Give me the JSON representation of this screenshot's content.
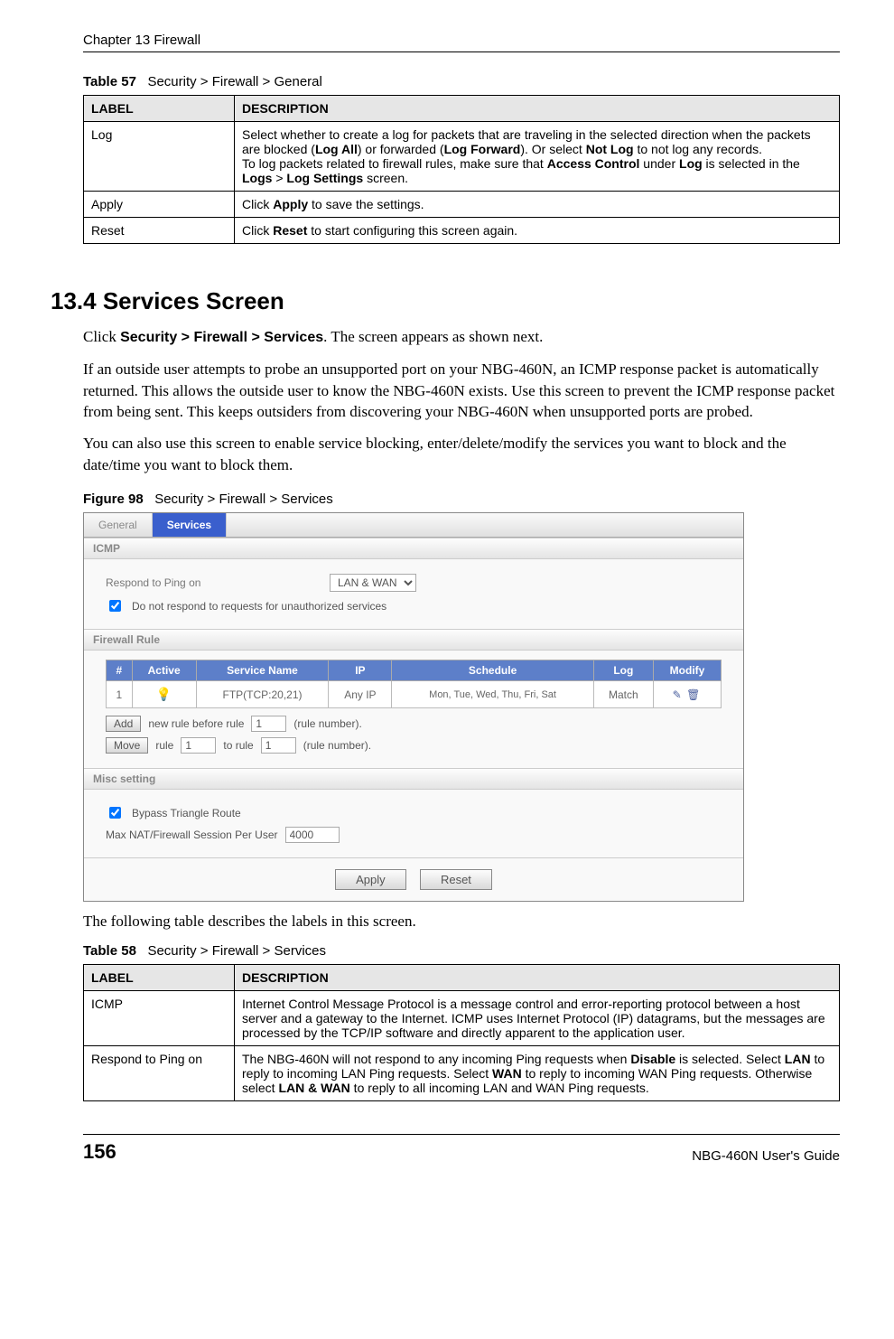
{
  "header": {
    "chapter": "Chapter 13 Firewall"
  },
  "table57": {
    "caption_num": "Table 57",
    "caption_text": "Security > Firewall > General",
    "headers": {
      "label": "LABEL",
      "desc": "DESCRIPTION"
    },
    "rows": [
      {
        "label": "Log",
        "desc_parts": {
          "p1a": "Select whether to create a log for packets that are traveling in the selected direction when the packets are blocked (",
          "log_all": "Log All",
          "p1b": ") or forwarded (",
          "log_forward": "Log Forward",
          "p1c": "). Or select ",
          "not_log": "Not Log",
          "p1d": " to not log any records.",
          "p2a": "To log packets related to firewall rules, make sure that ",
          "access_control": "Access Control",
          "p2b": " under ",
          "log_word": "Log",
          "p2c": " is selected in the ",
          "logs": "Logs",
          "gt": " > ",
          "log_settings": "Log Settings",
          "p2d": " screen."
        }
      },
      {
        "label": "Apply",
        "desc_parts": {
          "a": "Click ",
          "b": "Apply",
          "c": " to save the settings."
        }
      },
      {
        "label": "Reset",
        "desc_parts": {
          "a": "Click ",
          "b": "Reset",
          "c": " to start configuring this screen again."
        }
      }
    ]
  },
  "section134": {
    "heading": "13.4   Services Screen",
    "para1": {
      "a": "Click ",
      "b": "Security > Firewall > Services",
      "c": ". The screen appears as shown next."
    },
    "para2": "If an outside user attempts to probe an unsupported port on your NBG-460N, an ICMP response packet is automatically returned. This allows the outside user to know the NBG-460N exists. Use this screen to prevent the ICMP response packet from being sent. This keeps outsiders from discovering your NBG-460N when unsupported ports are probed.",
    "para3": "You can also use this screen to enable service blocking, enter/delete/modify the services you want to block and the date/time you want to block them."
  },
  "figure98": {
    "caption_num": "Figure 98",
    "caption_text": "Security > Firewall > Services"
  },
  "shot": {
    "tabs": {
      "general": "General",
      "services": "Services"
    },
    "sections": {
      "icmp": "ICMP",
      "rule": "Firewall Rule",
      "misc": "Misc setting"
    },
    "icmp": {
      "respond_label": "Respond to Ping on",
      "respond_value": "LAN & WAN",
      "nonauth_label": "Do not respond to requests for unauthorized services"
    },
    "rule_headers": {
      "num": "#",
      "active": "Active",
      "service": "Service Name",
      "ip": "IP",
      "schedule": "Schedule",
      "log": "Log",
      "modify": "Modify"
    },
    "rule_row": {
      "num": "1",
      "service": "FTP(TCP:20,21)",
      "ip": "Any IP",
      "schedule": "Mon, Tue, Wed, Thu, Fri, Sat",
      "log": "Match"
    },
    "addrow": {
      "add_btn": "Add",
      "add_text_a": "new rule before rule",
      "add_value": "1",
      "add_text_b": "(rule number).",
      "move_btn": "Move",
      "move_text_a": "rule",
      "move_value_a": "1",
      "move_text_b": "to rule",
      "move_value_b": "1",
      "move_text_c": "(rule number)."
    },
    "misc": {
      "bypass_label": "Bypass Triangle Route",
      "max_label": "Max NAT/Firewall Session Per User",
      "max_value": "4000"
    },
    "buttons": {
      "apply": "Apply",
      "reset": "Reset"
    }
  },
  "after_fig": "The following table describes the labels in this screen.",
  "table58": {
    "caption_num": "Table 58",
    "caption_text": "Security > Firewall > Services",
    "headers": {
      "label": "LABEL",
      "desc": "DESCRIPTION"
    },
    "rows": [
      {
        "label": "ICMP",
        "desc": "Internet Control Message Protocol is a message control and error-reporting protocol between a host server and a gateway to the Internet. ICMP uses Internet Protocol (IP) datagrams, but the messages are processed by the TCP/IP software and directly apparent to the application user."
      },
      {
        "label": "Respond to Ping on",
        "desc_parts": {
          "a": "The NBG-460N will not respond to any incoming Ping requests when ",
          "disable": "Disable",
          "b": " is selected. Select ",
          "lan": "LAN",
          "c": " to reply to incoming LAN Ping requests. Select ",
          "wan": "WAN",
          "d": " to reply to incoming WAN Ping requests. Otherwise select ",
          "lanwan": "LAN & WAN",
          "e": " to reply to all incoming LAN and WAN Ping requests."
        }
      }
    ]
  },
  "footer": {
    "page": "156",
    "guide": "NBG-460N User's Guide"
  }
}
